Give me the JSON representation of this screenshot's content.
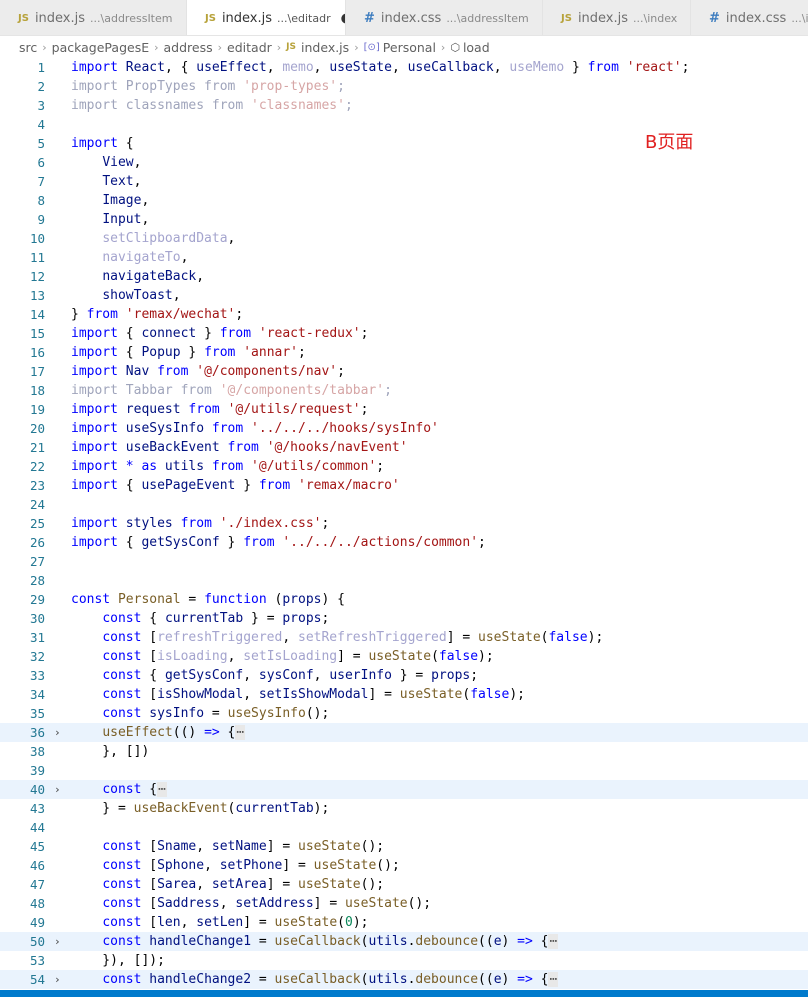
{
  "tabs": [
    {
      "icon": "JS",
      "name": "index.js",
      "path": "...\\addressItem",
      "active": false
    },
    {
      "icon": "JS",
      "name": "index.js",
      "path": "...\\editadr",
      "active": true,
      "dirty": "●"
    },
    {
      "icon": "#",
      "name": "index.css",
      "path": "...\\addressItem",
      "active": false
    },
    {
      "icon": "JS",
      "name": "index.js",
      "path": "...\\index",
      "active": false
    },
    {
      "icon": "#",
      "name": "index.css",
      "path": "...\\ind",
      "active": false
    }
  ],
  "breadcrumb": {
    "parts": [
      "src",
      "packagePagesE",
      "address",
      "editadr"
    ],
    "file_icon": "JS",
    "file": "index.js",
    "symbol_icon": "[⊙]",
    "symbol": "Personal",
    "method_icon": "⬡",
    "method": "load"
  },
  "annotation": "B页面",
  "lines": [
    {
      "n": "1",
      "t": [
        [
          "kw",
          "import"
        ],
        [
          "id",
          " React"
        ],
        [
          "pl",
          ", { "
        ],
        [
          "id",
          "useEffect"
        ],
        [
          "pl",
          ", "
        ],
        [
          "dim",
          "memo"
        ],
        [
          "pl",
          ", "
        ],
        [
          "id",
          "useState"
        ],
        [
          "pl",
          ", "
        ],
        [
          "id",
          "useCallback"
        ],
        [
          "pl",
          ", "
        ],
        [
          "dim",
          "useMemo"
        ],
        [
          "pl",
          " } "
        ],
        [
          "kw",
          "from"
        ],
        [
          "pl",
          " "
        ],
        [
          "str",
          "'react'"
        ],
        [
          "pl",
          ";"
        ]
      ]
    },
    {
      "n": "2",
      "t": [
        [
          "dimi",
          "import PropTypes from "
        ],
        [
          "dims",
          "'prop-types'"
        ],
        [
          "dimi",
          ";"
        ]
      ]
    },
    {
      "n": "3",
      "t": [
        [
          "dimi",
          "import classnames from "
        ],
        [
          "dims",
          "'classnames'"
        ],
        [
          "dimi",
          ";"
        ]
      ]
    },
    {
      "n": "4",
      "t": []
    },
    {
      "n": "5",
      "t": [
        [
          "kw",
          "import"
        ],
        [
          "pl",
          " {"
        ]
      ]
    },
    {
      "n": "6",
      "t": [
        [
          "pl",
          "    "
        ],
        [
          "id",
          "View"
        ],
        [
          "pl",
          ","
        ]
      ]
    },
    {
      "n": "7",
      "t": [
        [
          "pl",
          "    "
        ],
        [
          "id",
          "Text"
        ],
        [
          "pl",
          ","
        ]
      ]
    },
    {
      "n": "8",
      "t": [
        [
          "pl",
          "    "
        ],
        [
          "id",
          "Image"
        ],
        [
          "pl",
          ","
        ]
      ]
    },
    {
      "n": "9",
      "t": [
        [
          "pl",
          "    "
        ],
        [
          "id",
          "Input"
        ],
        [
          "pl",
          ","
        ]
      ]
    },
    {
      "n": "10",
      "t": [
        [
          "pl",
          "    "
        ],
        [
          "dim",
          "setClipboardData"
        ],
        [
          "pl",
          ","
        ]
      ]
    },
    {
      "n": "11",
      "t": [
        [
          "pl",
          "    "
        ],
        [
          "dim",
          "navigateTo"
        ],
        [
          "pl",
          ","
        ]
      ]
    },
    {
      "n": "12",
      "t": [
        [
          "pl",
          "    "
        ],
        [
          "id",
          "navigateBack"
        ],
        [
          "pl",
          ","
        ]
      ]
    },
    {
      "n": "13",
      "t": [
        [
          "pl",
          "    "
        ],
        [
          "id",
          "showToast"
        ],
        [
          "pl",
          ","
        ]
      ]
    },
    {
      "n": "14",
      "t": [
        [
          "pl",
          "} "
        ],
        [
          "kw",
          "from"
        ],
        [
          "pl",
          " "
        ],
        [
          "str",
          "'remax/wechat'"
        ],
        [
          "pl",
          ";"
        ]
      ]
    },
    {
      "n": "15",
      "t": [
        [
          "kw",
          "import"
        ],
        [
          "pl",
          " { "
        ],
        [
          "id",
          "connect"
        ],
        [
          "pl",
          " } "
        ],
        [
          "kw",
          "from"
        ],
        [
          "pl",
          " "
        ],
        [
          "str",
          "'react-redux'"
        ],
        [
          "pl",
          ";"
        ]
      ]
    },
    {
      "n": "16",
      "t": [
        [
          "kw",
          "import"
        ],
        [
          "pl",
          " { "
        ],
        [
          "id",
          "Popup"
        ],
        [
          "pl",
          " } "
        ],
        [
          "kw",
          "from"
        ],
        [
          "pl",
          " "
        ],
        [
          "str",
          "'annar'"
        ],
        [
          "pl",
          ";"
        ]
      ]
    },
    {
      "n": "17",
      "t": [
        [
          "kw",
          "import"
        ],
        [
          "id",
          " Nav"
        ],
        [
          "pl",
          " "
        ],
        [
          "kw",
          "from"
        ],
        [
          "pl",
          " "
        ],
        [
          "str",
          "'@/components/nav'"
        ],
        [
          "pl",
          ";"
        ]
      ]
    },
    {
      "n": "18",
      "t": [
        [
          "dimi",
          "import Tabbar from "
        ],
        [
          "dims",
          "'@/components/tabbar'"
        ],
        [
          "dimi",
          ";"
        ]
      ]
    },
    {
      "n": "19",
      "t": [
        [
          "kw",
          "import"
        ],
        [
          "id",
          " request"
        ],
        [
          "pl",
          " "
        ],
        [
          "kw",
          "from"
        ],
        [
          "pl",
          " "
        ],
        [
          "str",
          "'@/utils/request'"
        ],
        [
          "pl",
          ";"
        ]
      ]
    },
    {
      "n": "20",
      "t": [
        [
          "kw",
          "import"
        ],
        [
          "id",
          " useSysInfo"
        ],
        [
          "pl",
          " "
        ],
        [
          "kw",
          "from"
        ],
        [
          "pl",
          " "
        ],
        [
          "str",
          "'../../../hooks/sysInfo'"
        ]
      ]
    },
    {
      "n": "21",
      "t": [
        [
          "kw",
          "import"
        ],
        [
          "id",
          " useBackEvent"
        ],
        [
          "pl",
          " "
        ],
        [
          "kw",
          "from"
        ],
        [
          "pl",
          " "
        ],
        [
          "str",
          "'@/hooks/navEvent'"
        ]
      ]
    },
    {
      "n": "22",
      "t": [
        [
          "kw",
          "import"
        ],
        [
          "pl",
          " "
        ],
        [
          "kw",
          "*"
        ],
        [
          "pl",
          " "
        ],
        [
          "kw",
          "as"
        ],
        [
          "id",
          " utils"
        ],
        [
          "pl",
          " "
        ],
        [
          "kw",
          "from"
        ],
        [
          "pl",
          " "
        ],
        [
          "str",
          "'@/utils/common'"
        ],
        [
          "pl",
          ";"
        ]
      ]
    },
    {
      "n": "23",
      "t": [
        [
          "kw",
          "import"
        ],
        [
          "pl",
          " { "
        ],
        [
          "id",
          "usePageEvent"
        ],
        [
          "pl",
          " } "
        ],
        [
          "kw",
          "from"
        ],
        [
          "pl",
          " "
        ],
        [
          "str",
          "'remax/macro'"
        ]
      ]
    },
    {
      "n": "24",
      "t": []
    },
    {
      "n": "25",
      "t": [
        [
          "kw",
          "import"
        ],
        [
          "id",
          " styles"
        ],
        [
          "pl",
          " "
        ],
        [
          "kw",
          "from"
        ],
        [
          "pl",
          " "
        ],
        [
          "str",
          "'./index.css'"
        ],
        [
          "pl",
          ";"
        ]
      ]
    },
    {
      "n": "26",
      "t": [
        [
          "kw",
          "import"
        ],
        [
          "pl",
          " { "
        ],
        [
          "id",
          "getSysConf"
        ],
        [
          "pl",
          " } "
        ],
        [
          "kw",
          "from"
        ],
        [
          "pl",
          " "
        ],
        [
          "str",
          "'../../../actions/common'"
        ],
        [
          "pl",
          ";"
        ]
      ]
    },
    {
      "n": "27",
      "t": []
    },
    {
      "n": "28",
      "t": []
    },
    {
      "n": "29",
      "t": [
        [
          "kw",
          "const"
        ],
        [
          "pl",
          " "
        ],
        [
          "fn",
          "Personal"
        ],
        [
          "pl",
          " = "
        ],
        [
          "kw",
          "function"
        ],
        [
          "pl",
          " ("
        ],
        [
          "id",
          "props"
        ],
        [
          "pl",
          ") {"
        ]
      ]
    },
    {
      "n": "30",
      "t": [
        [
          "pl",
          "    "
        ],
        [
          "kw",
          "const"
        ],
        [
          "pl",
          " { "
        ],
        [
          "id",
          "currentTab"
        ],
        [
          "pl",
          " } = "
        ],
        [
          "id",
          "props"
        ],
        [
          "pl",
          ";"
        ]
      ]
    },
    {
      "n": "31",
      "t": [
        [
          "pl",
          "    "
        ],
        [
          "kw",
          "const"
        ],
        [
          "pl",
          " ["
        ],
        [
          "dim",
          "refreshTriggered"
        ],
        [
          "pl",
          ", "
        ],
        [
          "dim",
          "setRefreshTriggered"
        ],
        [
          "pl",
          "] = "
        ],
        [
          "fn",
          "useState"
        ],
        [
          "pl",
          "("
        ],
        [
          "kw",
          "false"
        ],
        [
          "pl",
          ");"
        ]
      ]
    },
    {
      "n": "32",
      "t": [
        [
          "pl",
          "    "
        ],
        [
          "kw",
          "const"
        ],
        [
          "pl",
          " ["
        ],
        [
          "dim",
          "isLoading"
        ],
        [
          "pl",
          ", "
        ],
        [
          "dim",
          "setIsLoading"
        ],
        [
          "pl",
          "] = "
        ],
        [
          "fn",
          "useState"
        ],
        [
          "pl",
          "("
        ],
        [
          "kw",
          "false"
        ],
        [
          "pl",
          ");"
        ]
      ]
    },
    {
      "n": "33",
      "t": [
        [
          "pl",
          "    "
        ],
        [
          "kw",
          "const"
        ],
        [
          "pl",
          " { "
        ],
        [
          "id",
          "getSysConf"
        ],
        [
          "pl",
          ", "
        ],
        [
          "id",
          "sysConf"
        ],
        [
          "pl",
          ", "
        ],
        [
          "id",
          "userInfo"
        ],
        [
          "pl",
          " } = "
        ],
        [
          "id",
          "props"
        ],
        [
          "pl",
          ";"
        ]
      ]
    },
    {
      "n": "34",
      "t": [
        [
          "pl",
          "    "
        ],
        [
          "kw",
          "const"
        ],
        [
          "pl",
          " ["
        ],
        [
          "id",
          "isShowModal"
        ],
        [
          "pl",
          ", "
        ],
        [
          "id",
          "setIsShowModal"
        ],
        [
          "pl",
          "] = "
        ],
        [
          "fn",
          "useState"
        ],
        [
          "pl",
          "("
        ],
        [
          "kw",
          "false"
        ],
        [
          "pl",
          ");"
        ]
      ]
    },
    {
      "n": "35",
      "t": [
        [
          "pl",
          "    "
        ],
        [
          "kw",
          "const"
        ],
        [
          "pl",
          " "
        ],
        [
          "id",
          "sysInfo"
        ],
        [
          "pl",
          " = "
        ],
        [
          "fn",
          "useSysInfo"
        ],
        [
          "pl",
          "();"
        ]
      ]
    },
    {
      "n": "36",
      "fold": "›",
      "hl": true,
      "t": [
        [
          "pl",
          "    "
        ],
        [
          "fn",
          "useEffect"
        ],
        [
          "pl",
          "(() "
        ],
        [
          "kw",
          "=>"
        ],
        [
          "pl",
          " {"
        ],
        [
          "ell",
          "⋯"
        ]
      ]
    },
    {
      "n": "38",
      "t": [
        [
          "pl",
          "    }, [])"
        ]
      ]
    },
    {
      "n": "39",
      "t": []
    },
    {
      "n": "40",
      "fold": "›",
      "hl": true,
      "t": [
        [
          "pl",
          "    "
        ],
        [
          "kw",
          "const"
        ],
        [
          "pl",
          " {"
        ],
        [
          "ell",
          "⋯"
        ]
      ]
    },
    {
      "n": "43",
      "t": [
        [
          "pl",
          "    } = "
        ],
        [
          "fn",
          "useBackEvent"
        ],
        [
          "pl",
          "("
        ],
        [
          "id",
          "currentTab"
        ],
        [
          "pl",
          ");"
        ]
      ]
    },
    {
      "n": "44",
      "t": []
    },
    {
      "n": "45",
      "t": [
        [
          "pl",
          "    "
        ],
        [
          "kw",
          "const"
        ],
        [
          "pl",
          " ["
        ],
        [
          "id",
          "Sname"
        ],
        [
          "pl",
          ", "
        ],
        [
          "id",
          "setName"
        ],
        [
          "pl",
          "] = "
        ],
        [
          "fn",
          "useState"
        ],
        [
          "pl",
          "();"
        ]
      ]
    },
    {
      "n": "46",
      "t": [
        [
          "pl",
          "    "
        ],
        [
          "kw",
          "const"
        ],
        [
          "pl",
          " ["
        ],
        [
          "id",
          "Sphone"
        ],
        [
          "pl",
          ", "
        ],
        [
          "id",
          "setPhone"
        ],
        [
          "pl",
          "] = "
        ],
        [
          "fn",
          "useState"
        ],
        [
          "pl",
          "();"
        ]
      ]
    },
    {
      "n": "47",
      "t": [
        [
          "pl",
          "    "
        ],
        [
          "kw",
          "const"
        ],
        [
          "pl",
          " ["
        ],
        [
          "id",
          "Sarea"
        ],
        [
          "pl",
          ", "
        ],
        [
          "id",
          "setArea"
        ],
        [
          "pl",
          "] = "
        ],
        [
          "fn",
          "useState"
        ],
        [
          "pl",
          "();"
        ]
      ]
    },
    {
      "n": "48",
      "t": [
        [
          "pl",
          "    "
        ],
        [
          "kw",
          "const"
        ],
        [
          "pl",
          " ["
        ],
        [
          "id",
          "Saddress"
        ],
        [
          "pl",
          ", "
        ],
        [
          "id",
          "setAddress"
        ],
        [
          "pl",
          "] = "
        ],
        [
          "fn",
          "useState"
        ],
        [
          "pl",
          "();"
        ]
      ]
    },
    {
      "n": "49",
      "t": [
        [
          "pl",
          "    "
        ],
        [
          "kw",
          "const"
        ],
        [
          "pl",
          " ["
        ],
        [
          "id",
          "len"
        ],
        [
          "pl",
          ", "
        ],
        [
          "id",
          "setLen"
        ],
        [
          "pl",
          "] = "
        ],
        [
          "fn",
          "useState"
        ],
        [
          "pl",
          "("
        ],
        [
          "num",
          "0"
        ],
        [
          "pl",
          ");"
        ]
      ]
    },
    {
      "n": "50",
      "fold": "›",
      "hl": true,
      "t": [
        [
          "pl",
          "    "
        ],
        [
          "kw",
          "const"
        ],
        [
          "pl",
          " "
        ],
        [
          "id",
          "handleChange1"
        ],
        [
          "pl",
          " = "
        ],
        [
          "fn",
          "useCallback"
        ],
        [
          "pl",
          "("
        ],
        [
          "id",
          "utils"
        ],
        [
          "pl",
          "."
        ],
        [
          "fn",
          "debounce"
        ],
        [
          "pl",
          "(("
        ],
        [
          "id",
          "e"
        ],
        [
          "pl",
          ") "
        ],
        [
          "kw",
          "=>"
        ],
        [
          "pl",
          " {"
        ],
        [
          "ell",
          "⋯"
        ]
      ]
    },
    {
      "n": "53",
      "t": [
        [
          "pl",
          "    }), []);"
        ]
      ]
    },
    {
      "n": "54",
      "fold": "›",
      "hl": true,
      "t": [
        [
          "pl",
          "    "
        ],
        [
          "kw",
          "const"
        ],
        [
          "pl",
          " "
        ],
        [
          "id",
          "handleChange2"
        ],
        [
          "pl",
          " = "
        ],
        [
          "fn",
          "useCallback"
        ],
        [
          "pl",
          "("
        ],
        [
          "id",
          "utils"
        ],
        [
          "pl",
          "."
        ],
        [
          "fn",
          "debounce"
        ],
        [
          "pl",
          "(("
        ],
        [
          "id",
          "e"
        ],
        [
          "pl",
          ") "
        ],
        [
          "kw",
          "=>"
        ],
        [
          "pl",
          " {"
        ],
        [
          "ell",
          "⋯"
        ]
      ]
    }
  ]
}
